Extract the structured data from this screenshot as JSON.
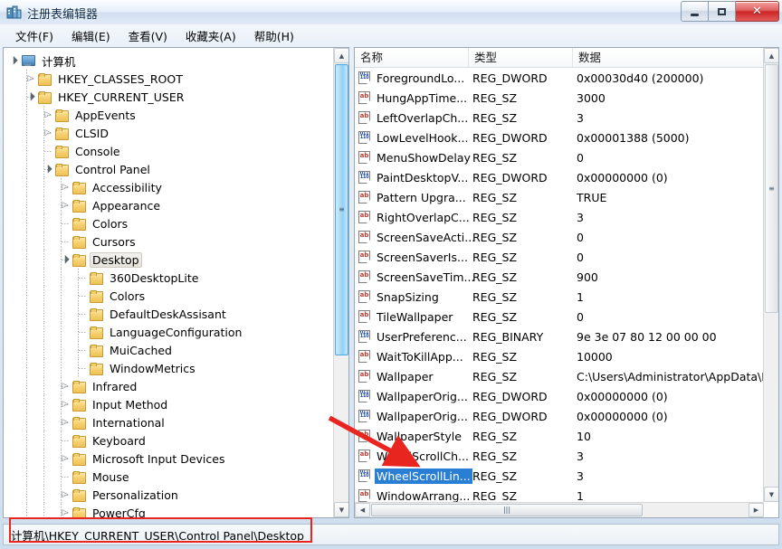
{
  "window": {
    "title": "注册表编辑器",
    "icon": "registry-editor-icon",
    "controls": {
      "minimize": "–",
      "maximize": "▢",
      "close": "✕"
    }
  },
  "menu": [
    {
      "label": "文件(F)"
    },
    {
      "label": "编辑(E)"
    },
    {
      "label": "查看(V)"
    },
    {
      "label": "收藏夹(A)"
    },
    {
      "label": "帮助(H)"
    }
  ],
  "tree": {
    "nodes": [
      {
        "label": "计算机",
        "depth": 0,
        "twist": "expanded",
        "icon": "computer-icon",
        "selected": false
      },
      {
        "label": "HKEY_CLASSES_ROOT",
        "depth": 1,
        "twist": "collapsed",
        "icon": "folder-icon",
        "selected": false
      },
      {
        "label": "HKEY_CURRENT_USER",
        "depth": 1,
        "twist": "expanded",
        "icon": "folder-icon",
        "selected": false
      },
      {
        "label": "AppEvents",
        "depth": 2,
        "twist": "collapsed",
        "icon": "folder-icon",
        "selected": false
      },
      {
        "label": "CLSID",
        "depth": 2,
        "twist": "collapsed",
        "icon": "folder-icon",
        "selected": false
      },
      {
        "label": "Console",
        "depth": 2,
        "twist": "none",
        "icon": "folder-icon",
        "selected": false
      },
      {
        "label": "Control Panel",
        "depth": 2,
        "twist": "expanded",
        "icon": "folder-icon",
        "selected": false
      },
      {
        "label": "Accessibility",
        "depth": 3,
        "twist": "collapsed",
        "icon": "folder-icon",
        "selected": false
      },
      {
        "label": "Appearance",
        "depth": 3,
        "twist": "collapsed",
        "icon": "folder-icon",
        "selected": false
      },
      {
        "label": "Colors",
        "depth": 3,
        "twist": "none",
        "icon": "folder-icon",
        "selected": false
      },
      {
        "label": "Cursors",
        "depth": 3,
        "twist": "none",
        "icon": "folder-icon",
        "selected": false
      },
      {
        "label": "Desktop",
        "depth": 3,
        "twist": "expanded",
        "icon": "folder-icon",
        "selected": true
      },
      {
        "label": "360DesktopLite",
        "depth": 4,
        "twist": "none",
        "icon": "folder-icon",
        "selected": false
      },
      {
        "label": "Colors",
        "depth": 4,
        "twist": "none",
        "icon": "folder-icon",
        "selected": false
      },
      {
        "label": "DefaultDeskAssisant",
        "depth": 4,
        "twist": "none",
        "icon": "folder-icon",
        "selected": false
      },
      {
        "label": "LanguageConfiguration",
        "depth": 4,
        "twist": "none",
        "icon": "folder-icon",
        "selected": false
      },
      {
        "label": "MuiCached",
        "depth": 4,
        "twist": "none",
        "icon": "folder-icon",
        "selected": false
      },
      {
        "label": "WindowMetrics",
        "depth": 4,
        "twist": "none",
        "icon": "folder-icon",
        "selected": false
      },
      {
        "label": "Infrared",
        "depth": 3,
        "twist": "collapsed",
        "icon": "folder-icon",
        "selected": false
      },
      {
        "label": "Input Method",
        "depth": 3,
        "twist": "collapsed",
        "icon": "folder-icon",
        "selected": false
      },
      {
        "label": "International",
        "depth": 3,
        "twist": "collapsed",
        "icon": "folder-icon",
        "selected": false
      },
      {
        "label": "Keyboard",
        "depth": 3,
        "twist": "none",
        "icon": "folder-icon",
        "selected": false
      },
      {
        "label": "Microsoft Input Devices",
        "depth": 3,
        "twist": "collapsed",
        "icon": "folder-icon",
        "selected": false
      },
      {
        "label": "Mouse",
        "depth": 3,
        "twist": "none",
        "icon": "folder-icon",
        "selected": false
      },
      {
        "label": "Personalization",
        "depth": 3,
        "twist": "collapsed",
        "icon": "folder-icon",
        "selected": false
      },
      {
        "label": "PowerCfg",
        "depth": 3,
        "twist": "collapsed",
        "icon": "folder-icon",
        "selected": false
      }
    ]
  },
  "list": {
    "columns": [
      {
        "label": "名称",
        "key": "name"
      },
      {
        "label": "类型",
        "key": "type"
      },
      {
        "label": "数据",
        "key": "data"
      }
    ],
    "rows": [
      {
        "name": "ForegroundLo...",
        "type": "REG_DWORD",
        "data": "0x00030d40 (200000)",
        "icon": "binary-value-icon",
        "selected": false
      },
      {
        "name": "HungAppTime...",
        "type": "REG_SZ",
        "data": "3000",
        "icon": "string-value-icon",
        "selected": false
      },
      {
        "name": "LeftOverlapCh...",
        "type": "REG_SZ",
        "data": "3",
        "icon": "string-value-icon",
        "selected": false
      },
      {
        "name": "LowLevelHook...",
        "type": "REG_DWORD",
        "data": "0x00001388 (5000)",
        "icon": "binary-value-icon",
        "selected": false
      },
      {
        "name": "MenuShowDelay",
        "type": "REG_SZ",
        "data": "0",
        "icon": "string-value-icon",
        "selected": false
      },
      {
        "name": "PaintDesktopV...",
        "type": "REG_DWORD",
        "data": "0x00000000 (0)",
        "icon": "binary-value-icon",
        "selected": false
      },
      {
        "name": "Pattern Upgra...",
        "type": "REG_SZ",
        "data": "TRUE",
        "icon": "string-value-icon",
        "selected": false
      },
      {
        "name": "RightOverlapC...",
        "type": "REG_SZ",
        "data": "3",
        "icon": "string-value-icon",
        "selected": false
      },
      {
        "name": "ScreenSaveActi...",
        "type": "REG_SZ",
        "data": "0",
        "icon": "string-value-icon",
        "selected": false
      },
      {
        "name": "ScreenSaverIs...",
        "type": "REG_SZ",
        "data": "0",
        "icon": "string-value-icon",
        "selected": false
      },
      {
        "name": "ScreenSaveTim...",
        "type": "REG_SZ",
        "data": "900",
        "icon": "string-value-icon",
        "selected": false
      },
      {
        "name": "SnapSizing",
        "type": "REG_SZ",
        "data": "1",
        "icon": "string-value-icon",
        "selected": false
      },
      {
        "name": "TileWallpaper",
        "type": "REG_SZ",
        "data": "0",
        "icon": "string-value-icon",
        "selected": false
      },
      {
        "name": "UserPreferenc...",
        "type": "REG_BINARY",
        "data": "9e 3e 07 80 12 00 00 00",
        "icon": "binary-value-icon",
        "selected": false
      },
      {
        "name": "WaitToKillApp...",
        "type": "REG_SZ",
        "data": "10000",
        "icon": "string-value-icon",
        "selected": false
      },
      {
        "name": "Wallpaper",
        "type": "REG_SZ",
        "data": "C:\\Users\\Administrator\\AppData\\R",
        "icon": "string-value-icon",
        "selected": false
      },
      {
        "name": "WallpaperOrig...",
        "type": "REG_DWORD",
        "data": "0x00000000 (0)",
        "icon": "binary-value-icon",
        "selected": false
      },
      {
        "name": "WallpaperOrig...",
        "type": "REG_DWORD",
        "data": "0x00000000 (0)",
        "icon": "binary-value-icon",
        "selected": false
      },
      {
        "name": "WallpaperStyle",
        "type": "REG_SZ",
        "data": "10",
        "icon": "string-value-icon",
        "selected": false
      },
      {
        "name": "WheelScrollCh...",
        "type": "REG_SZ",
        "data": "3",
        "icon": "string-value-icon",
        "selected": false
      },
      {
        "name": "WheelScrollLin...",
        "type": "REG_SZ",
        "data": "3",
        "icon": "binary-value-icon",
        "selected": true
      },
      {
        "name": "WindowArrang...",
        "type": "REG_SZ",
        "data": "1",
        "icon": "string-value-icon",
        "selected": false
      }
    ]
  },
  "statusbar": {
    "path": "计算机\\HKEY_CURRENT_USER\\Control Panel\\Desktop"
  },
  "annotations": {
    "highlight_color": "#e8251f",
    "arrow": "red-arrow-pointing-to-wheelscrolllines",
    "rect": "red-rect-around-status-path"
  },
  "colors": {
    "selection_blue": "#2a7fd4",
    "annotation_red": "#e8251f",
    "scroll_hover_blue": "#96d0f3"
  }
}
